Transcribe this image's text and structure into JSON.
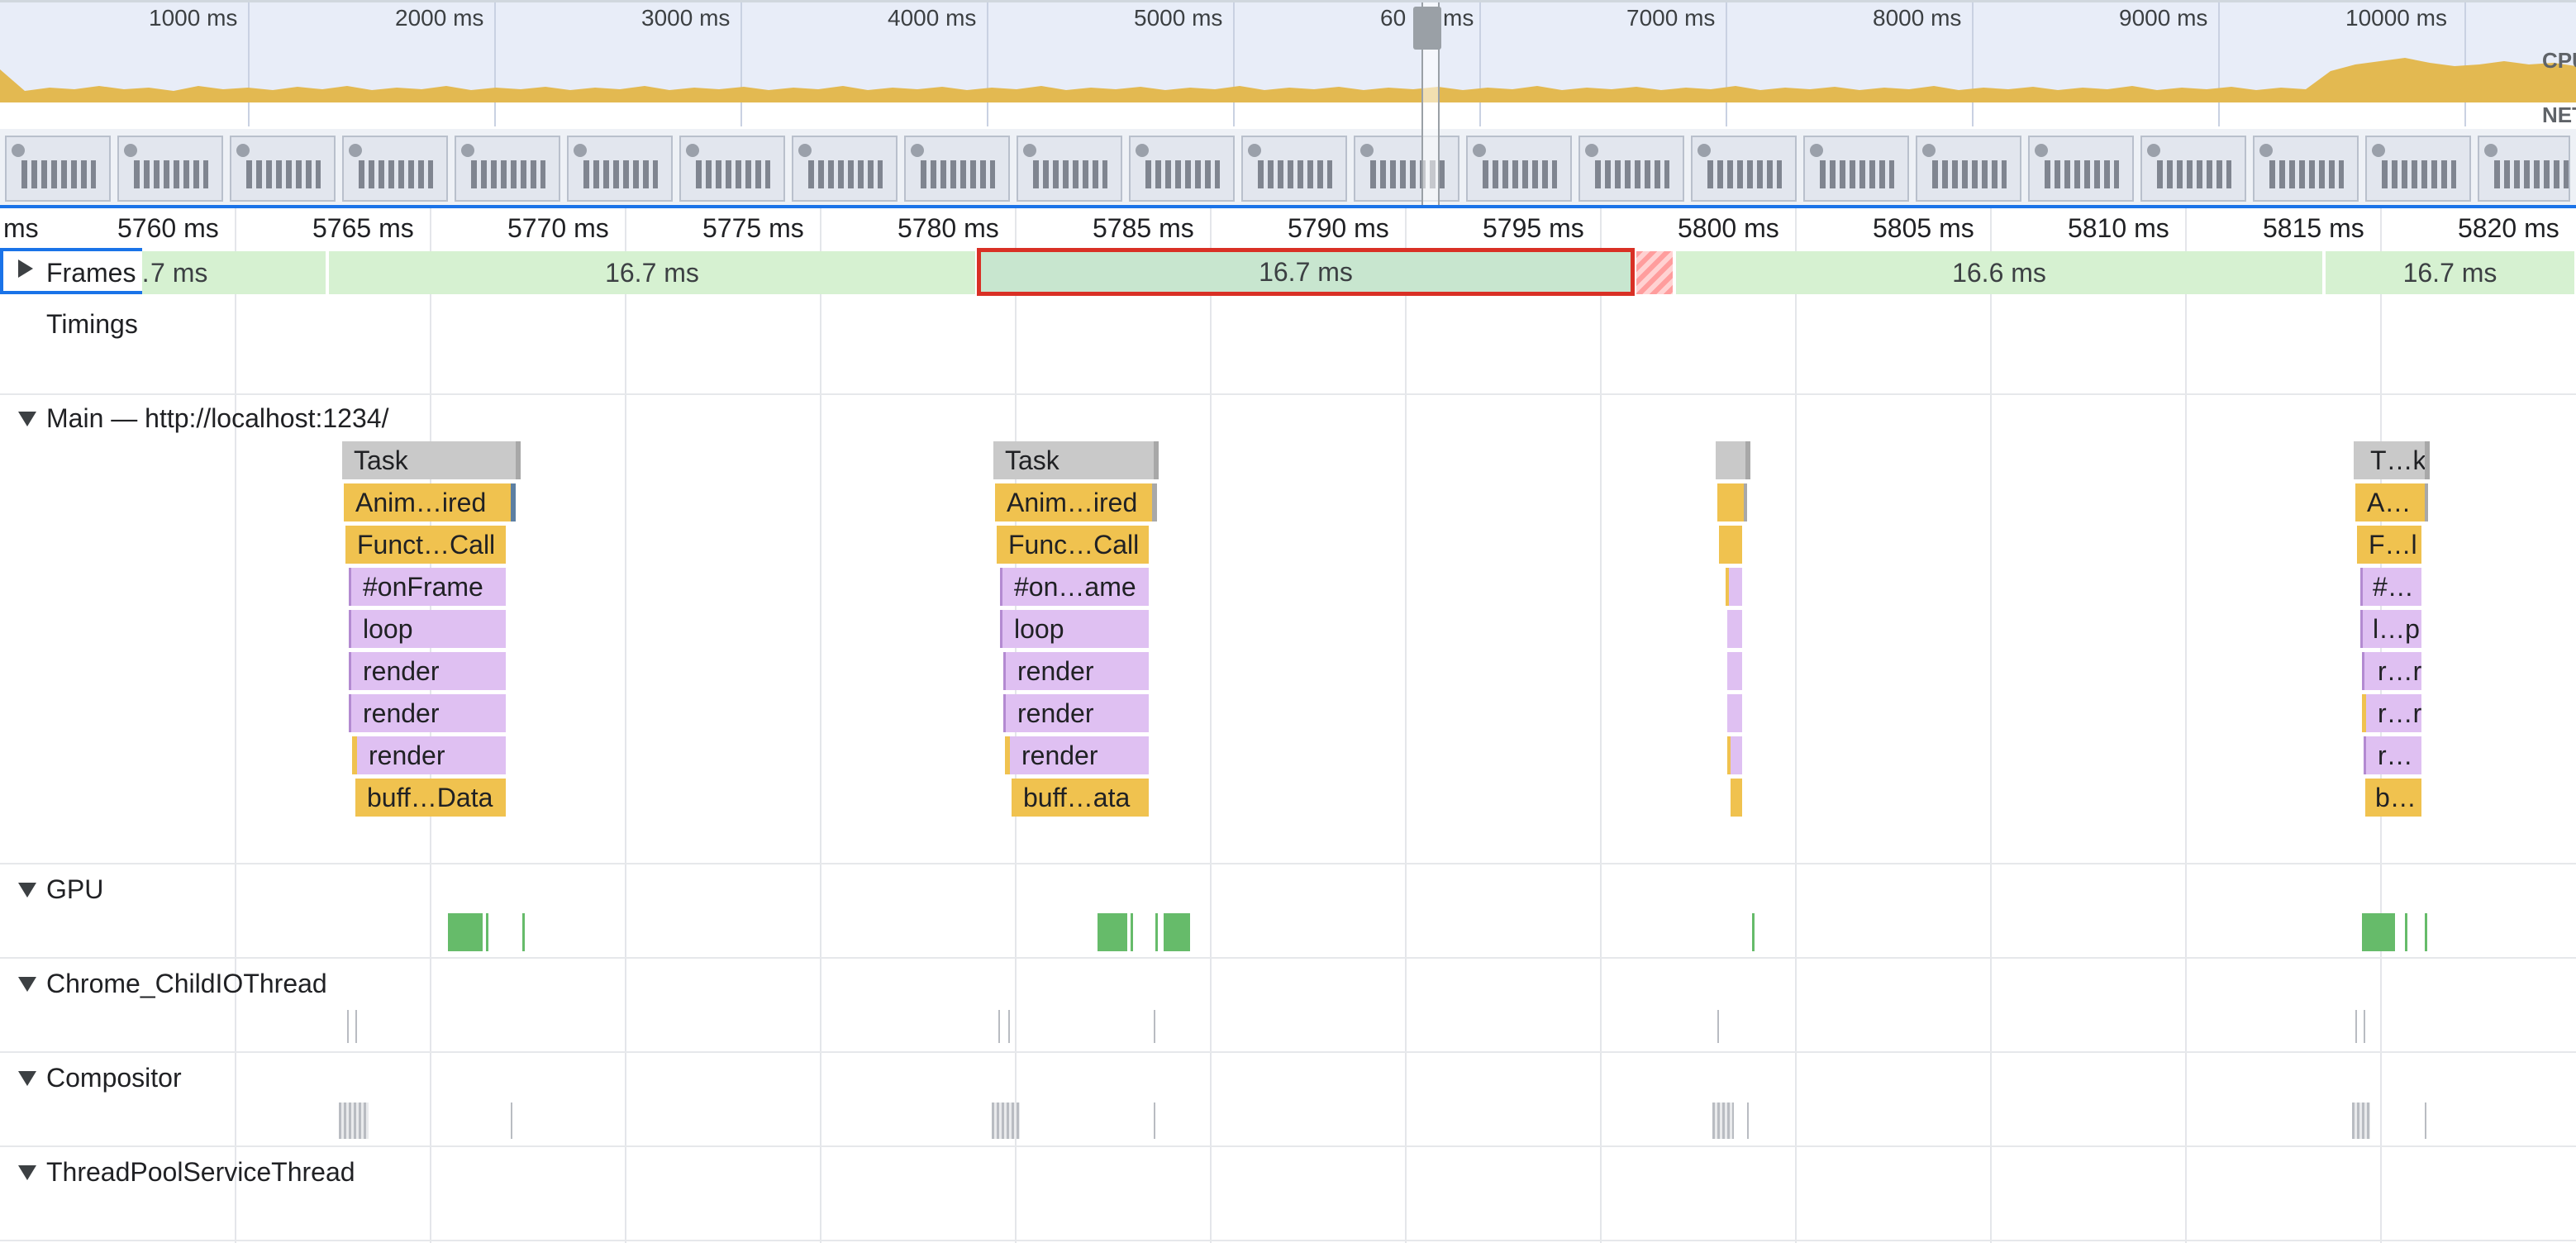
{
  "overview": {
    "time_labels": [
      "1000 ms",
      "2000 ms",
      "3000 ms",
      "4000 ms",
      "5000 ms",
      "60",
      "ms",
      "7000 ms",
      "8000 ms",
      "9000 ms",
      "10000 ms"
    ],
    "cpu_label": "CPU",
    "net_label": "NET"
  },
  "ruler": {
    "labels": [
      "ms",
      "5760 ms",
      "5765 ms",
      "5770 ms",
      "5775 ms",
      "5780 ms",
      "5785 ms",
      "5790 ms",
      "5795 ms",
      "5800 ms",
      "5805 ms",
      "5810 ms",
      "5815 ms",
      "5820 ms"
    ]
  },
  "frames": {
    "title": "Frames",
    "segments": [
      "…7 ms",
      "16.7 ms",
      "16.7 ms",
      "16.6 ms",
      "16.7 ms"
    ]
  },
  "timings": {
    "title": "Timings"
  },
  "main": {
    "title": "Main — http://localhost:1234/",
    "group1": [
      "Task",
      "Anim…ired",
      "Funct…Call",
      "#onFrame",
      "loop",
      "render",
      "render",
      "render",
      "buff…Data"
    ],
    "group2": [
      "Task",
      "Anim…ired",
      "Func…Call",
      "#on…ame",
      "loop",
      "render",
      "render",
      "render",
      "buff…ata"
    ],
    "group4": [
      "T…k",
      "A…",
      "F…l",
      "#…",
      "l…p",
      "r…r",
      "r…r",
      "r…",
      "b…"
    ]
  },
  "tracks": {
    "gpu": "GPU",
    "child_io": "Chrome_ChildIOThread",
    "compositor": "Compositor",
    "thread_pool": "ThreadPoolServiceThread"
  },
  "colors": {
    "frame_ok": "#d6f1d1",
    "frame_selected_border": "#d93025",
    "task": "#c9c9c9",
    "scripting": "#f0c24f",
    "function": "#dfc0f2",
    "gpu": "#66bb6a",
    "cpu_area": "#e3b951",
    "overview_accent": "#1a73e8"
  }
}
